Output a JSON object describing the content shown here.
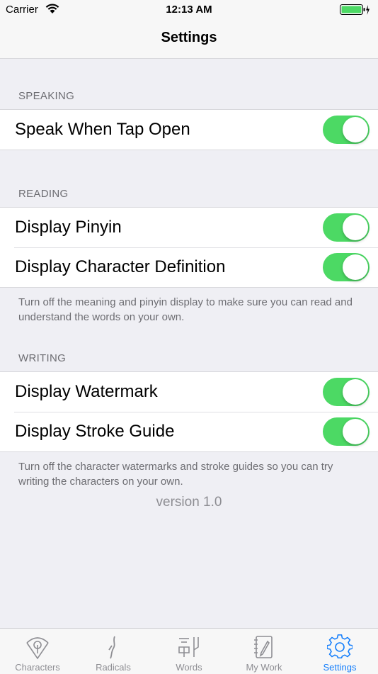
{
  "status_bar": {
    "carrier": "Carrier",
    "time": "12:13 AM"
  },
  "nav": {
    "title": "Settings"
  },
  "sections": [
    {
      "header": "SPEAKING",
      "rows": [
        {
          "label": "Speak When Tap Open",
          "on": true
        }
      ]
    },
    {
      "header": "READING",
      "rows": [
        {
          "label": "Display Pinyin",
          "on": true
        },
        {
          "label": "Display Character Definition",
          "on": true
        }
      ],
      "footer": "Turn off the meaning and pinyin display to make sure you can read and understand the words on your own."
    },
    {
      "header": "WRITING",
      "rows": [
        {
          "label": "Display Watermark",
          "on": true
        },
        {
          "label": "Display Stroke Guide",
          "on": true
        }
      ],
      "footer": "Turn off the character watermarks and stroke guides so you can try writing the characters on your own."
    }
  ],
  "version": "version 1.0",
  "tabs": [
    {
      "label": "Characters",
      "icon": "characters-icon"
    },
    {
      "label": "Radicals",
      "icon": "radicals-icon"
    },
    {
      "label": "Words",
      "icon": "words-icon"
    },
    {
      "label": "My Work",
      "icon": "my-work-icon"
    },
    {
      "label": "Settings",
      "icon": "gear-icon",
      "active": true
    }
  ],
  "colors": {
    "toggle_on": "#4cd964",
    "tab_active": "#147efb",
    "tab_inactive": "#8e8e93",
    "background": "#efeff4"
  }
}
